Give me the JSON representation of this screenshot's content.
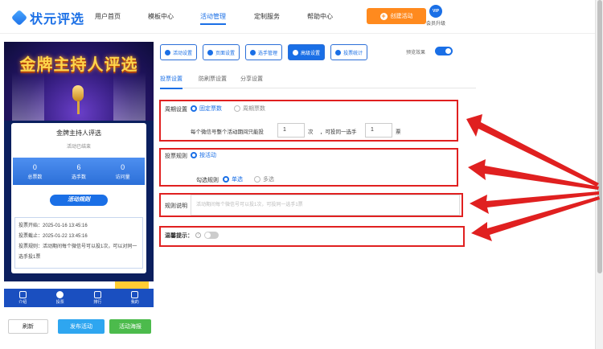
{
  "nav": {
    "logo": "状元评选",
    "items": [
      "用户首页",
      "模板中心",
      "活动管理",
      "定制服务",
      "帮助中心"
    ],
    "active_index": 2,
    "create_button": "创建活动",
    "vip_badge": "VIP",
    "vip_label": "会员升级"
  },
  "phone": {
    "banner_title": "金牌主持人评选",
    "card_title": "金牌主持人评选",
    "status": "活动已结束",
    "stats": [
      {
        "value": "0",
        "label": "总票数"
      },
      {
        "value": "6",
        "label": "选手数"
      },
      {
        "value": "0",
        "label": "访问量"
      }
    ],
    "rule_badge": "活动规则",
    "rules": [
      "投票开始：2025-01-16 13:45:16",
      "投票截止：2025-01-22 13:45:16",
      "投票规则：活动期间每个微信号可以投1次，可以对同一选手投1票"
    ],
    "tabs": [
      "介绍",
      "投票",
      "排行",
      "我的"
    ],
    "active_tab": 1
  },
  "actions": {
    "refresh": "刷新",
    "publish": "发布活动",
    "poster": "活动海报"
  },
  "toolbar": {
    "items": [
      "活动设置",
      "页面设置",
      "选手管理",
      "高级设置",
      "投票统计"
    ],
    "active_index": 3,
    "preview_label": "预览效果"
  },
  "subtabs": {
    "items": [
      "投票设置",
      "防刷票设置",
      "分享设置"
    ],
    "active_index": 0
  },
  "form": {
    "cycle_label": "周期设置",
    "cycle_options": [
      "固定票数",
      "周期票数"
    ],
    "cycle_text1": "每个微信号整个活动期间只能投",
    "cycle_count": "1",
    "cycle_unit1": "次",
    "cycle_text2": "，可投同一选手",
    "cycle_vote": "1",
    "cycle_unit2": "票",
    "rule_label": "投票规则",
    "rule_option": "按活动",
    "check_label": "勾选规则",
    "check_options": [
      "单选",
      "多选"
    ],
    "desc_label": "规则说明",
    "desc_placeholder": "活动期间每个微信号可以投1次，可投同一选手1票",
    "tip_label": "温馨提示："
  },
  "colors": {
    "brand": "#1a6fe6",
    "orange": "#ff8a1e",
    "highlight": "#e02020"
  }
}
